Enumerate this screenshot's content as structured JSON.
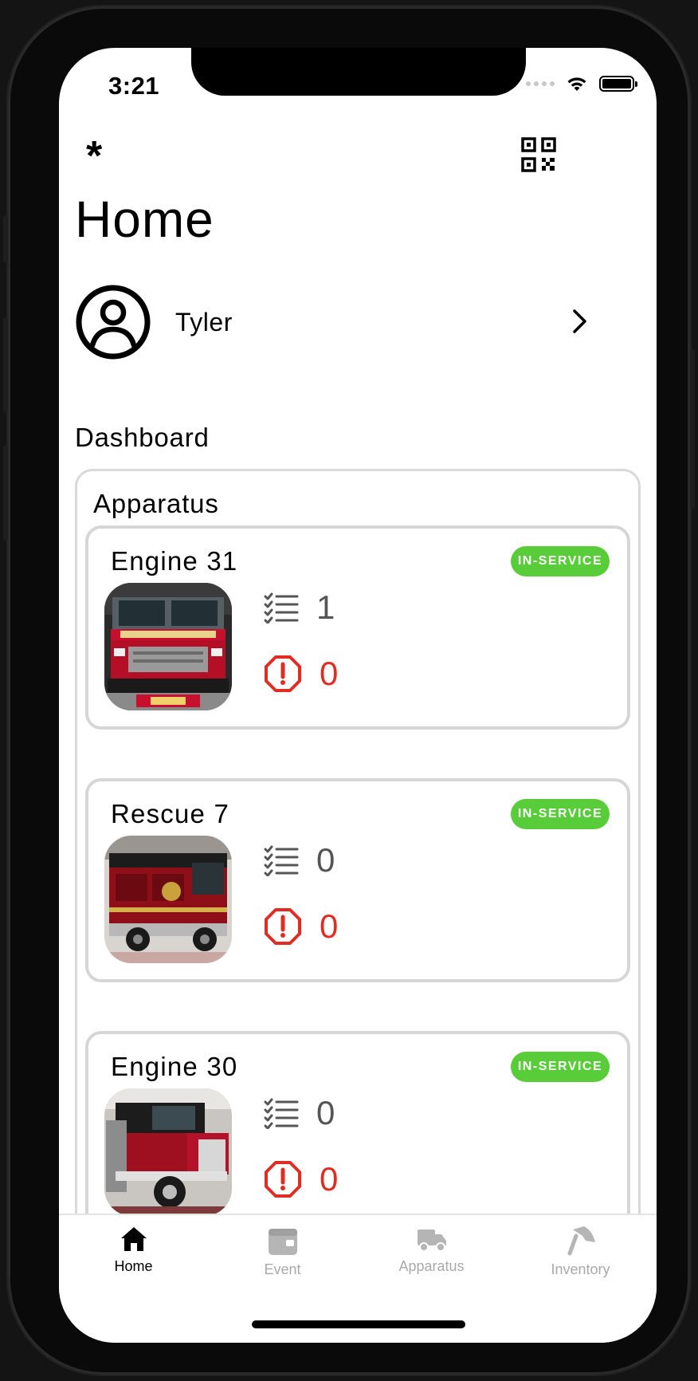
{
  "status_bar": {
    "time": "3:21"
  },
  "header": {
    "star_label": "*",
    "title": "Home",
    "qr_icon": "qr-code-icon"
  },
  "profile": {
    "name": "Tyler",
    "avatar_icon": "user-circle-icon",
    "chevron_icon": "chevron-right-icon"
  },
  "dashboard": {
    "section_label": "Dashboard",
    "card_title": "Apparatus",
    "apparatus": [
      {
        "name": "Engine 31",
        "status": "IN-SERVICE",
        "tasks": "1",
        "issues": "0"
      },
      {
        "name": "Rescue 7",
        "status": "IN-SERVICE",
        "tasks": "0",
        "issues": "0"
      },
      {
        "name": "Engine 30",
        "status": "IN-SERVICE",
        "tasks": "0",
        "issues": "0"
      }
    ]
  },
  "tabbar": {
    "tabs": [
      {
        "label": "Home",
        "icon": "home-icon",
        "active": true
      },
      {
        "label": "Event",
        "icon": "calendar-icon",
        "active": false
      },
      {
        "label": "Apparatus",
        "icon": "truck-icon",
        "active": false
      },
      {
        "label": "Inventory",
        "icon": "axe-icon",
        "active": false
      }
    ]
  },
  "colors": {
    "status_green": "#59cc3a",
    "issue_red": "#e02d23",
    "tab_inactive": "#a9a9a9"
  }
}
